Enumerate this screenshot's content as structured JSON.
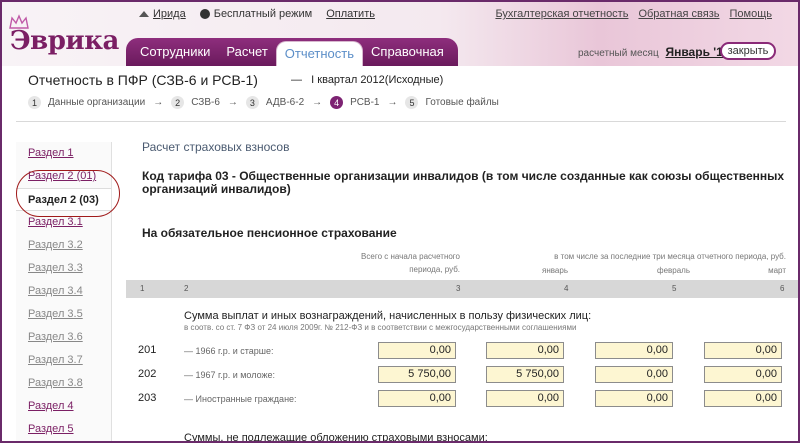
{
  "header": {
    "logo": "Эврика",
    "user": "Ирида",
    "mode": "Бесплатный режим",
    "pay": "Оплатить",
    "right_links": [
      "Бухгалтерская отчетность",
      "Обратная связь",
      "Помощь"
    ],
    "tabs": [
      "Сотрудники",
      "Расчет",
      "Отчетность",
      "Справочная"
    ],
    "active_tab": "Отчетность",
    "period_label": "расчетный месяц",
    "period_value": "Январь '12",
    "close_label": "закрыть"
  },
  "report": {
    "title": "Отчетность в ПФР (СЗВ-6 и РСВ-1)",
    "dash": "—",
    "sub": "I квартал 2012(Исходные)",
    "steps": [
      {
        "n": "1",
        "label": "Данные организации"
      },
      {
        "n": "2",
        "label": "СЗВ-6"
      },
      {
        "n": "3",
        "label": "АДВ-6-2"
      },
      {
        "n": "4",
        "label": "РСВ-1"
      },
      {
        "n": "5",
        "label": "Готовые файлы"
      }
    ],
    "arrow": "→"
  },
  "sidebar": {
    "items": [
      "Раздел 1",
      "Раздел 2 (01)",
      "Раздел 2 (03)",
      "Раздел 3.1",
      "Раздел 3.2",
      "Раздел 3.3",
      "Раздел 3.4",
      "Раздел 3.5",
      "Раздел 3.6",
      "Раздел 3.7",
      "Раздел 3.8",
      "Раздел 4",
      "Раздел 5"
    ]
  },
  "main": {
    "section_title": "Расчет страховых взносов",
    "tariff": "Код тарифа 03 - Общественные организации инвалидов (в том числе созданные как союзы общественных организаций инвалидов)",
    "subhead": "На обязательное пенсионное страхование",
    "col_total": "Всего с начала расчетного периода, руб.",
    "col_last3": "в том числе за последние три месяца отчетного периода, руб.",
    "months": [
      "январь",
      "февраль",
      "март"
    ],
    "col_numbers": [
      "1",
      "2",
      "3",
      "4",
      "5",
      "6"
    ],
    "block_title": "Сумма выплат и иных вознаграждений, начисленных в пользу физических лиц:",
    "block_note": "в соотв. со ст. 7 ФЗ от 24 июля 2009г. № 212-ФЗ и в соответствии с межгосударственными соглашениями",
    "rows": [
      {
        "code": "201",
        "label": "— 1966 г.р. и старше:",
        "values": [
          "0,00",
          "0,00",
          "0,00",
          "0,00"
        ]
      },
      {
        "code": "202",
        "label": "— 1967 г.р. и моложе:",
        "values": [
          "5 750,00",
          "5 750,00",
          "0,00",
          "0,00"
        ]
      },
      {
        "code": "203",
        "label": "— Иностранные граждане:",
        "values": [
          "0,00",
          "0,00",
          "0,00",
          "0,00"
        ]
      }
    ],
    "bottom_title": "Суммы, не подлежащие обложению страховыми взносами:"
  }
}
